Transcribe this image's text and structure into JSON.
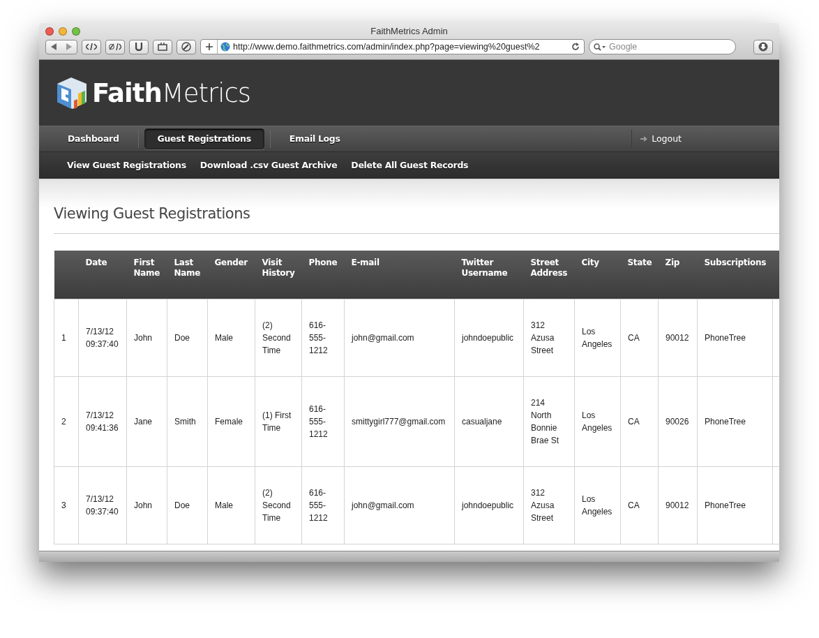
{
  "browser": {
    "title": "FaithMetrics Admin",
    "url": "http://www.demo.faithmetrics.com/admin/index.php?page=viewing%20guest%2",
    "search_placeholder": "Google"
  },
  "logo": {
    "bold": "Faith",
    "light": "Metrics"
  },
  "nav": [
    {
      "label": "Dashboard",
      "selected": false
    },
    {
      "label": "Guest Registrations",
      "selected": true
    },
    {
      "label": "Email Logs",
      "selected": false
    }
  ],
  "logout": "Logout",
  "subnav": [
    "View Guest Registrations",
    "Download .csv Guest Archive",
    "Delete All Guest Records"
  ],
  "page_title": "Viewing Guest Registrations",
  "table": {
    "columns": [
      "",
      "Date",
      "First Name",
      "Last Name",
      "Gender",
      "Visit History",
      "Phone",
      "E-mail",
      "Twitter Username",
      "Street Address",
      "City",
      "State",
      "Zip",
      "Subscriptions"
    ],
    "rows": [
      [
        "1",
        "7/13/12 09:37:40",
        "John",
        "Doe",
        "Male",
        "(2) Second Time",
        "616-555-1212",
        "john@gmail.com",
        "johndoepublic",
        "312 Azusa Street",
        "Los Angeles",
        "CA",
        "90012",
        "PhoneTree"
      ],
      [
        "2",
        "7/13/12 09:41:36",
        "Jane",
        "Smith",
        "Female",
        "(1) First Time",
        "616-555-1212",
        "smittygirl777@gmail.com",
        "casualjane",
        "214 North Bonnie Brae St",
        "Los Angeles",
        "CA",
        "90026",
        "PhoneTree"
      ],
      [
        "3",
        "7/13/12 09:37:40",
        "John",
        "Doe",
        "Male",
        "(2) Second Time",
        "616-555-1212",
        "john@gmail.com",
        "johndoepublic",
        "312 Azusa Street",
        "Los Angeles",
        "CA",
        "90012",
        "PhoneTree"
      ]
    ]
  }
}
